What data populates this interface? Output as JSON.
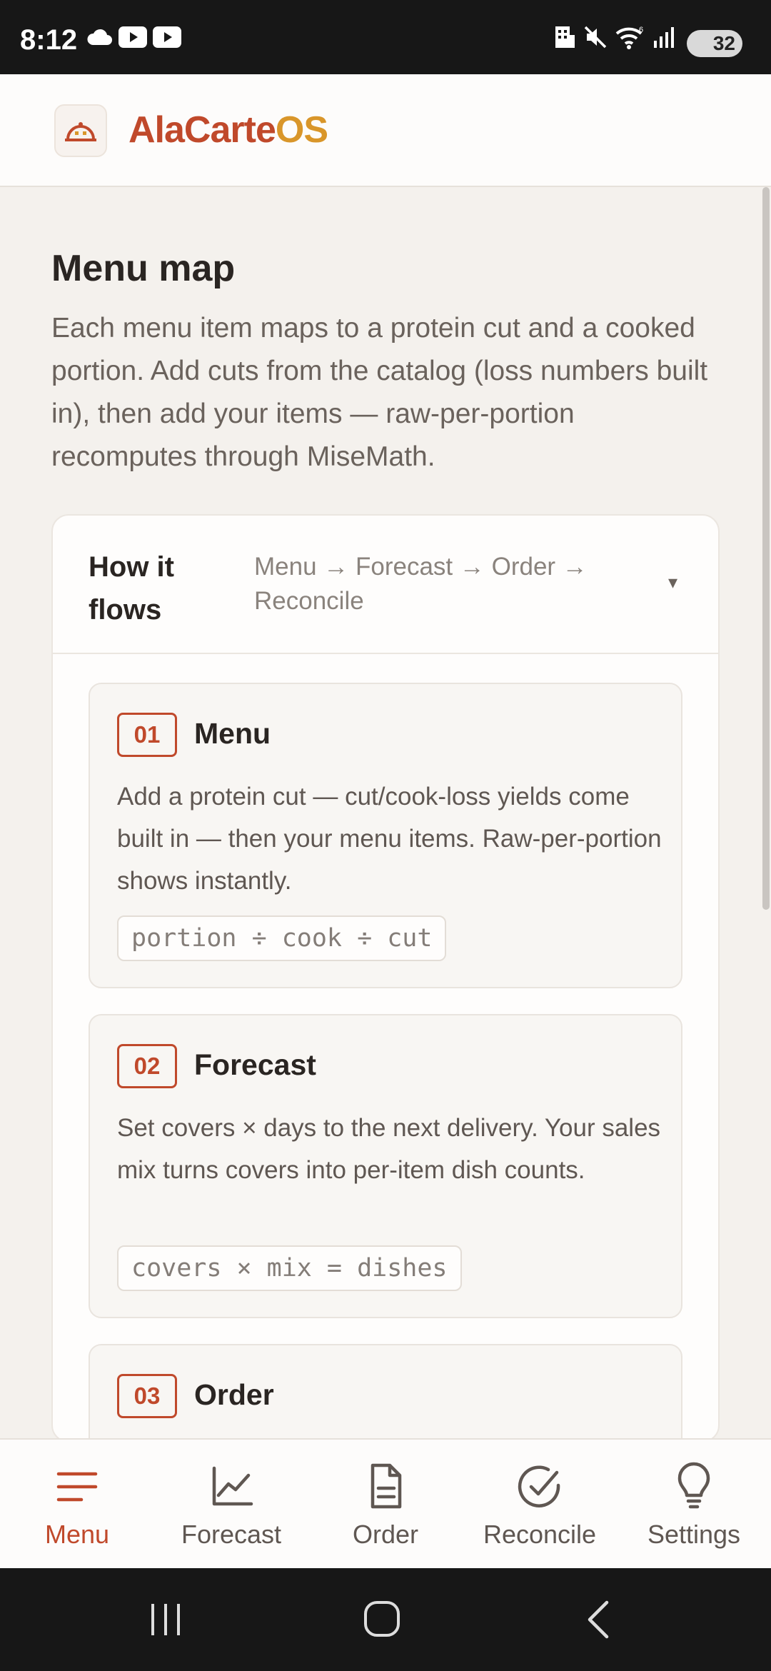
{
  "status_bar": {
    "time": "8:12",
    "battery": "32",
    "icons": [
      "cloud-icon",
      "youtube-icon",
      "youtube-icon",
      "building-icon",
      "mute-icon",
      "wifi-icon",
      "signal-icon",
      "battery-icon"
    ]
  },
  "header": {
    "brand_part1": "AlaCarte",
    "brand_part2": "OS",
    "logo_icon": "dome-icon"
  },
  "page": {
    "title": "Menu map",
    "description": "Each menu item maps to a protein cut and a cooked portion. Add cuts from the catalog (loss numbers built in), then add your items — raw-per-portion recomputes through MiseMath."
  },
  "flow": {
    "title": "How it flows",
    "subtitle": "Menu → Forecast → Order → Reconcile",
    "caret": "▾",
    "steps": [
      {
        "number": "01",
        "title": "Menu",
        "description": "Add a protein cut — cut/cook-loss yields come built in — then your menu items. Raw-per-portion shows instantly.",
        "formula": "portion ÷ cook ÷ cut"
      },
      {
        "number": "02",
        "title": "Forecast",
        "description": "Set covers × days to the next delivery. Your sales mix turns covers into per-item dish counts.",
        "formula": "covers × mix = dishes"
      },
      {
        "number": "03",
        "title": "Order"
      }
    ]
  },
  "bottom_nav": {
    "items": [
      {
        "label": "Menu",
        "icon": "menu-icon",
        "active": true
      },
      {
        "label": "Forecast",
        "icon": "chart-icon",
        "active": false
      },
      {
        "label": "Order",
        "icon": "document-icon",
        "active": false
      },
      {
        "label": "Reconcile",
        "icon": "check-circle-icon",
        "active": false
      },
      {
        "label": "Settings",
        "icon": "lightbulb-icon",
        "active": false
      }
    ]
  },
  "colors": {
    "accent": "#c0492b",
    "brand_secondary": "#d9962a",
    "background": "#f4f1ed"
  }
}
